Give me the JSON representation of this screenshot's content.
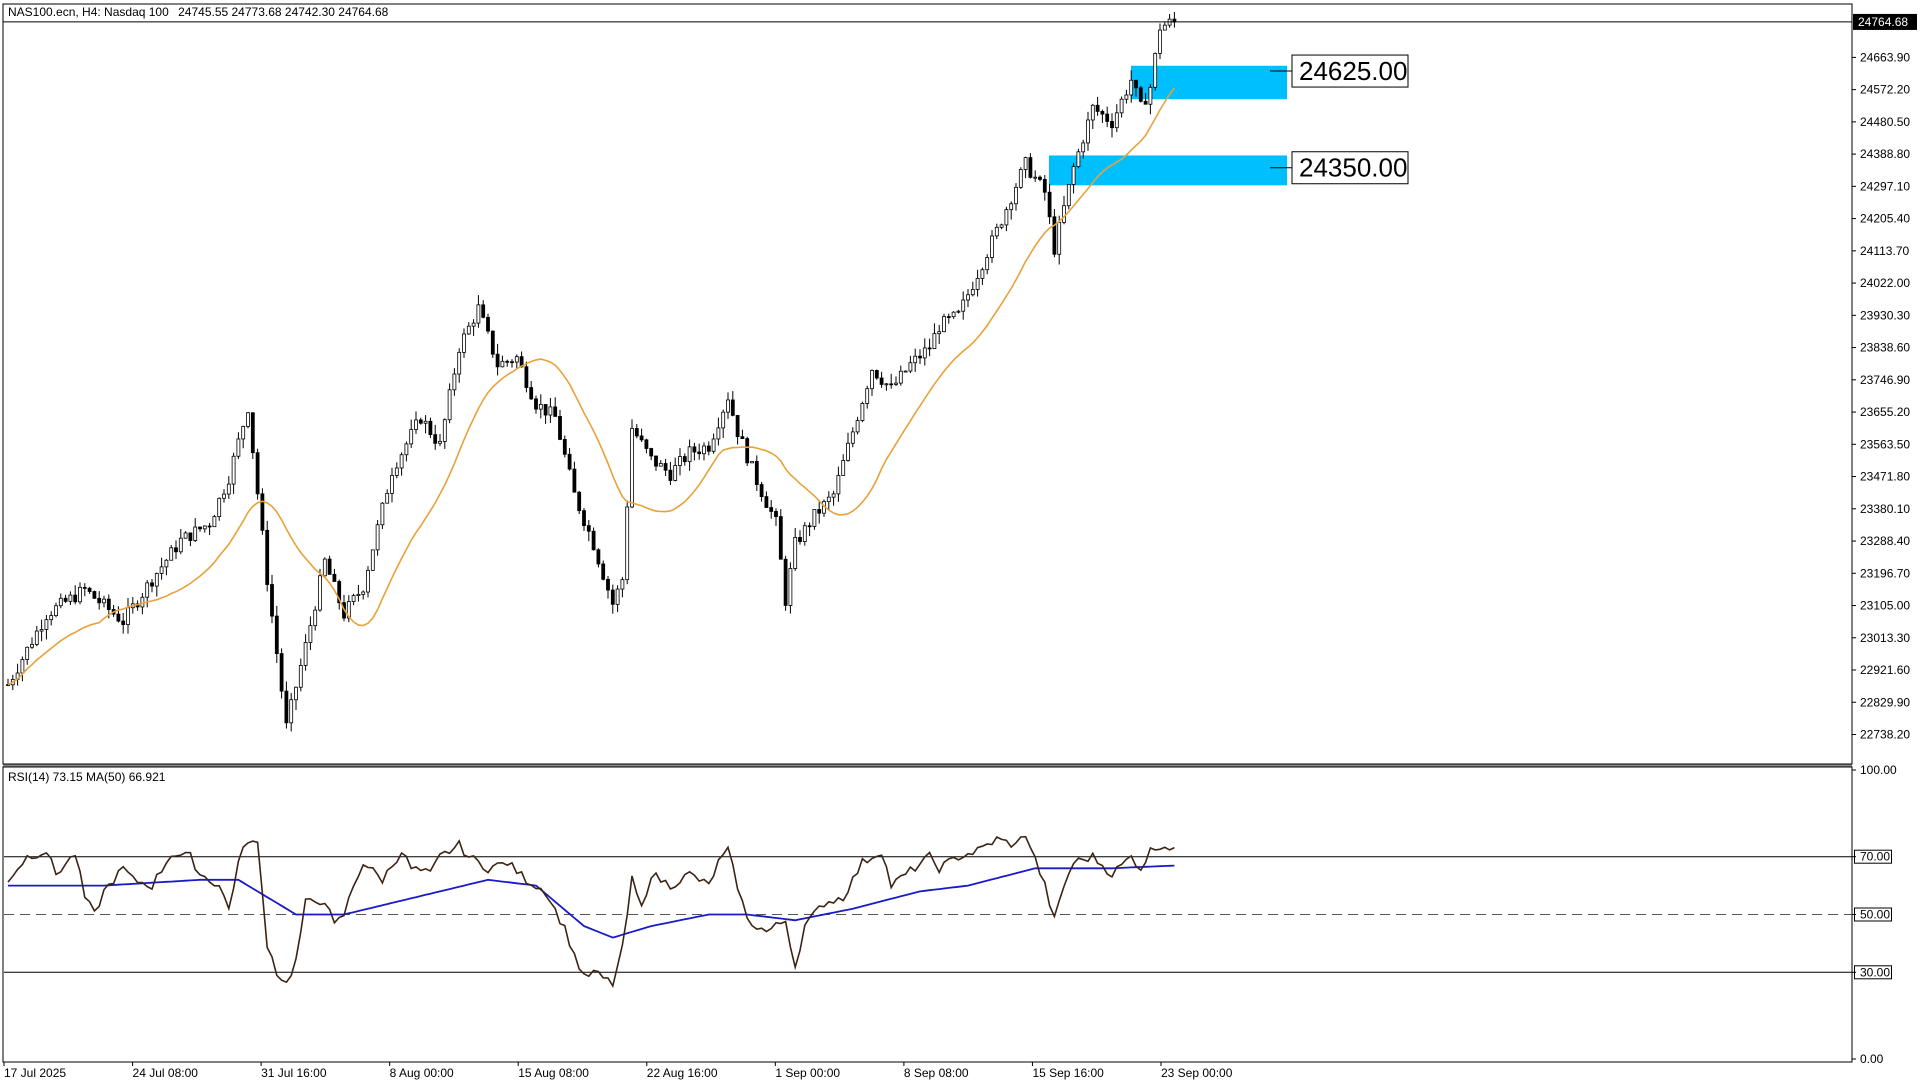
{
  "chart_data": [
    {
      "type": "candlestick",
      "symbol_label": "NAS100.ecn, H4:  Nasdaq 100",
      "ohlc_label": "24745.55 24773.68 24742.30 24764.68",
      "last_price_label": "24764.68",
      "last_price": 24764.68,
      "ylim": [
        22660,
        24810
      ],
      "y_ticks": [
        24663.9,
        24572.2,
        24480.5,
        24388.8,
        24297.1,
        24205.4,
        24113.7,
        24022.0,
        23930.3,
        23838.6,
        23746.9,
        23655.2,
        23563.5,
        23471.8,
        23380.1,
        23288.4,
        23196.7,
        23105.0,
        23013.3,
        22921.6,
        22829.9,
        22738.2
      ],
      "x_ticks": [
        "17 Jul 2025",
        "24 Jul 08:00",
        "31 Jul 16:00",
        "8 Aug 00:00",
        "15 Aug 08:00",
        "22 Aug 16:00",
        "1 Sep 00:00",
        "8 Sep 08:00",
        "15 Sep 16:00",
        "23 Sep 00:00"
      ],
      "moving_average_color": "#e8a23a",
      "candle_color": "#000000",
      "zones": [
        {
          "label": "24625.00",
          "value": 24625.0,
          "low": 24545,
          "high": 24640,
          "color": "#00bfff"
        },
        {
          "label": "24350.00",
          "value": 24350.0,
          "low": 24300,
          "high": 24385,
          "color": "#00bfff"
        }
      ],
      "price_path": [
        [
          0,
          22880
        ],
        [
          8,
          23080
        ],
        [
          16,
          23150
        ],
        [
          24,
          23060
        ],
        [
          30,
          23180
        ],
        [
          36,
          23290
        ],
        [
          42,
          23340
        ],
        [
          46,
          23470
        ],
        [
          50,
          23670
        ],
        [
          54,
          23180
        ],
        [
          58,
          22760
        ],
        [
          62,
          22990
        ],
        [
          66,
          23230
        ],
        [
          70,
          23080
        ],
        [
          74,
          23160
        ],
        [
          80,
          23490
        ],
        [
          86,
          23640
        ],
        [
          90,
          23560
        ],
        [
          94,
          23840
        ],
        [
          98,
          23950
        ],
        [
          102,
          23790
        ],
        [
          106,
          23810
        ],
        [
          110,
          23680
        ],
        [
          114,
          23640
        ],
        [
          118,
          23420
        ],
        [
          122,
          23280
        ],
        [
          126,
          23110
        ],
        [
          128,
          23180
        ],
        [
          130,
          23610
        ],
        [
          134,
          23520
        ],
        [
          138,
          23480
        ],
        [
          142,
          23540
        ],
        [
          146,
          23560
        ],
        [
          150,
          23700
        ],
        [
          152,
          23600
        ],
        [
          156,
          23460
        ],
        [
          160,
          23340
        ],
        [
          162,
          23120
        ],
        [
          164,
          23280
        ],
        [
          168,
          23360
        ],
        [
          172,
          23420
        ],
        [
          176,
          23600
        ],
        [
          180,
          23780
        ],
        [
          184,
          23720
        ],
        [
          188,
          23790
        ],
        [
          192,
          23840
        ],
        [
          194,
          23900
        ],
        [
          198,
          23930
        ],
        [
          202,
          24050
        ],
        [
          206,
          24170
        ],
        [
          210,
          24300
        ],
        [
          212,
          24360
        ],
        [
          216,
          24280
        ],
        [
          218,
          24120
        ],
        [
          222,
          24350
        ],
        [
          226,
          24520
        ],
        [
          230,
          24480
        ],
        [
          234,
          24600
        ],
        [
          236,
          24520
        ],
        [
          238,
          24580
        ],
        [
          240,
          24750
        ],
        [
          242,
          24762
        ],
        [
          243,
          24764.68
        ]
      ],
      "rsi": {
        "label": "RSI(14) 73.15 MA(50) 66.921",
        "rsi_value": 73.15,
        "ma_value": 66.921,
        "ylim": [
          0,
          100
        ],
        "y_ticks": [
          100.0,
          70.0,
          50.0,
          30.0,
          0.0
        ],
        "levels": [
          70,
          50,
          30
        ],
        "rsi_color": "#3c2414",
        "ma_color": "#1a1ac8",
        "rsi_path": [
          [
            0,
            62
          ],
          [
            4,
            70
          ],
          [
            8,
            72
          ],
          [
            10,
            64
          ],
          [
            14,
            71
          ],
          [
            16,
            56
          ],
          [
            18,
            50
          ],
          [
            20,
            58
          ],
          [
            24,
            66
          ],
          [
            26,
            62
          ],
          [
            30,
            60
          ],
          [
            34,
            71
          ],
          [
            38,
            70
          ],
          [
            40,
            64
          ],
          [
            44,
            60
          ],
          [
            46,
            52
          ],
          [
            48,
            68
          ],
          [
            50,
            76
          ],
          [
            52,
            74
          ],
          [
            54,
            40
          ],
          [
            56,
            30
          ],
          [
            58,
            26
          ],
          [
            60,
            34
          ],
          [
            62,
            54
          ],
          [
            66,
            55
          ],
          [
            68,
            46
          ],
          [
            70,
            50
          ],
          [
            72,
            60
          ],
          [
            74,
            68
          ],
          [
            78,
            62
          ],
          [
            82,
            72
          ],
          [
            84,
            66
          ],
          [
            88,
            64
          ],
          [
            90,
            70
          ],
          [
            94,
            74
          ],
          [
            96,
            70
          ],
          [
            100,
            66
          ],
          [
            104,
            68
          ],
          [
            108,
            62
          ],
          [
            112,
            58
          ],
          [
            116,
            45
          ],
          [
            118,
            36
          ],
          [
            120,
            28
          ],
          [
            122,
            30
          ],
          [
            126,
            26
          ],
          [
            128,
            38
          ],
          [
            130,
            62
          ],
          [
            132,
            52
          ],
          [
            134,
            64
          ],
          [
            138,
            60
          ],
          [
            142,
            64
          ],
          [
            146,
            60
          ],
          [
            148,
            68
          ],
          [
            150,
            72
          ],
          [
            152,
            60
          ],
          [
            154,
            48
          ],
          [
            158,
            44
          ],
          [
            162,
            48
          ],
          [
            164,
            32
          ],
          [
            166,
            46
          ],
          [
            170,
            54
          ],
          [
            174,
            56
          ],
          [
            178,
            68
          ],
          [
            182,
            72
          ],
          [
            184,
            60
          ],
          [
            188,
            65
          ],
          [
            192,
            70
          ],
          [
            194,
            66
          ],
          [
            198,
            70
          ],
          [
            202,
            72
          ],
          [
            206,
            76
          ],
          [
            210,
            74
          ],
          [
            212,
            78
          ],
          [
            216,
            60
          ],
          [
            218,
            48
          ],
          [
            220,
            60
          ],
          [
            222,
            68
          ],
          [
            226,
            70
          ],
          [
            230,
            64
          ],
          [
            234,
            70
          ],
          [
            236,
            66
          ],
          [
            238,
            72
          ],
          [
            240,
            74
          ],
          [
            243,
            73.15
          ]
        ],
        "ma_path": [
          [
            0,
            60
          ],
          [
            20,
            60
          ],
          [
            40,
            62
          ],
          [
            48,
            62
          ],
          [
            60,
            50
          ],
          [
            70,
            50
          ],
          [
            80,
            54
          ],
          [
            90,
            58
          ],
          [
            100,
            62
          ],
          [
            110,
            60
          ],
          [
            120,
            46
          ],
          [
            126,
            42
          ],
          [
            134,
            46
          ],
          [
            146,
            50
          ],
          [
            154,
            50
          ],
          [
            164,
            48
          ],
          [
            176,
            52
          ],
          [
            190,
            58
          ],
          [
            200,
            60
          ],
          [
            214,
            66
          ],
          [
            218,
            66
          ],
          [
            230,
            66
          ],
          [
            243,
            66.921
          ]
        ]
      }
    }
  ]
}
